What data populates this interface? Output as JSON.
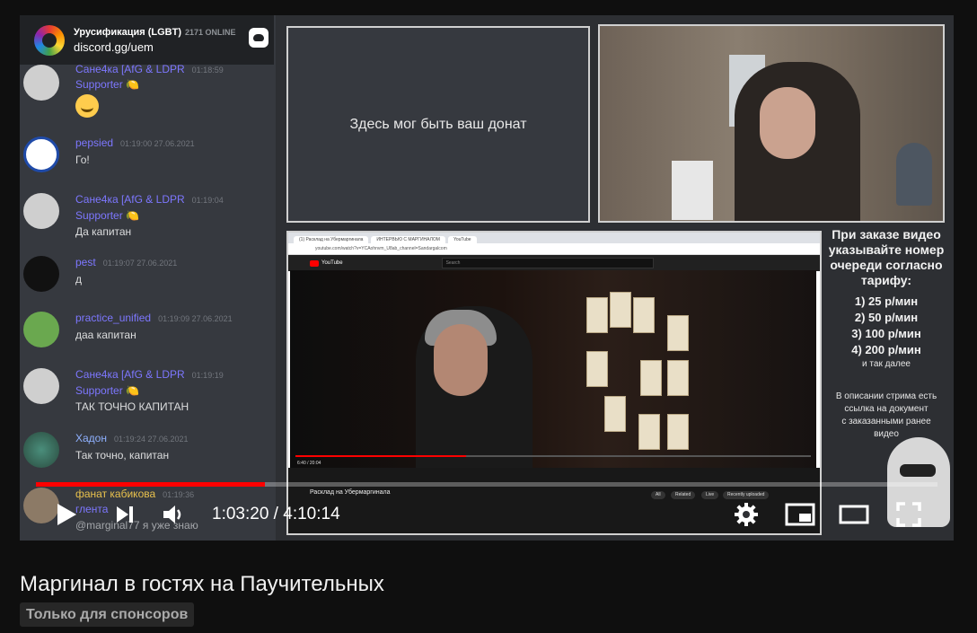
{
  "video": {
    "title": "Маргинал в гостях на Паучительных",
    "badge": "Только для спонсоров",
    "current_time": "1:03:20",
    "separator": " / ",
    "duration": "4:10:14",
    "progress_percent": 25.4
  },
  "discord": {
    "server_name": "Урусификация (LGBT)",
    "online": "2171 ONLINE",
    "invite": "discord.gg/uem",
    "messages": [
      {
        "user": "Сане4ка [AfG & LDPR",
        "role": "Supporter",
        "time": "01:18:59",
        "text": ""
      },
      {
        "user": "pepsied",
        "role": "",
        "time": "01:19:00 27.06.2021",
        "text": "Го!"
      },
      {
        "user": "Сане4ка [AfG & LDPR",
        "role": "Supporter",
        "time": "01:19:04",
        "text": "Да капитан"
      },
      {
        "user": "pest",
        "role": "",
        "time": "01:19:07 27.06.2021",
        "text": "д"
      },
      {
        "user": "practice_unified",
        "role": "",
        "time": "01:19:09 27.06.2021",
        "text": "даа капитан"
      },
      {
        "user": "Сане4ка [AfG & LDPR",
        "role": "Supporter",
        "time": "01:19:19",
        "text": "ТАК ТОЧНО КАПИТАН"
      },
      {
        "user": "Хадон",
        "role": "",
        "time": "01:19:24 27.06.2021",
        "text": "Так точно, капитан"
      },
      {
        "user": "фанат кабикова",
        "role": "",
        "time": "01:19:36",
        "text": "@marginal77 я уже знаю"
      }
    ],
    "partial_user": "глента"
  },
  "donate_text": "Здесь мог быть ваш донат",
  "rules": {
    "heading": [
      "При заказе видео",
      "указывайте номер",
      "очереди согласно",
      "тарифу:"
    ],
    "tariffs": [
      "1) 25 р/мин",
      "2) 50 р/мин",
      "3) 100 р/мин",
      "4) 200 р/мин"
    ],
    "etc": "и так далее",
    "note": [
      "В описании стрима есть",
      "ссылка на документ",
      "с заказанными ранее",
      "видео"
    ]
  },
  "embedded_youtube": {
    "tabs": [
      "(1) Расклад на Убермаргинала",
      "ИНТЕРВЬЮ С МАРГИНАЛОМ",
      "YouTube"
    ],
    "url": "youtube.com/watch?v=YCAohnvm_U8ab_channel=Sandargalcom",
    "search_placeholder": "Search",
    "logo_text": "YouTube",
    "video_title": "Расклад на Убермаргинала",
    "time": "6:40 / 20:04",
    "chips": [
      "All",
      "Related",
      "Live",
      "Recently uploaded"
    ]
  },
  "icons": {
    "play": "play-icon",
    "next": "next-icon",
    "volume": "volume-icon",
    "settings": "gear-icon",
    "miniplayer": "miniplayer-icon",
    "theater": "theater-icon",
    "fullscreen": "fullscreen-icon"
  },
  "colors": {
    "progress": "#ff0000",
    "discord_name": "#7d77ff",
    "page_bg": "#0f0f0f"
  }
}
